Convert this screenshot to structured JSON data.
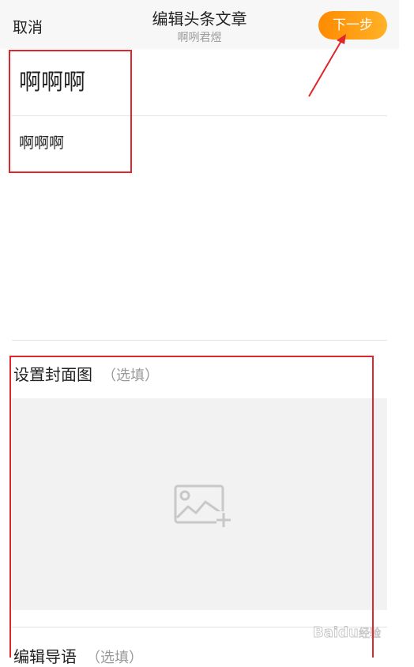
{
  "header": {
    "cancel_label": "取消",
    "title": "编辑头条文章",
    "subtitle": "啊咧君煜",
    "next_label": "下一步"
  },
  "editor": {
    "title_text": "啊啊啊",
    "body_text": "啊啊啊"
  },
  "cover": {
    "label": "设置封面图",
    "optional": "（选填）",
    "add_icon": "add-image-icon"
  },
  "intro": {
    "label": "编辑导语",
    "optional": "（选填）"
  },
  "watermark": {
    "logo_text": "Baidu经验",
    "url": "jingyan.baidu.com"
  },
  "colors": {
    "accent": "#ff9a12",
    "annotation_red": "#e0262d",
    "header_bg": "#f7f7f7",
    "upload_bg": "#f2f2f2"
  }
}
